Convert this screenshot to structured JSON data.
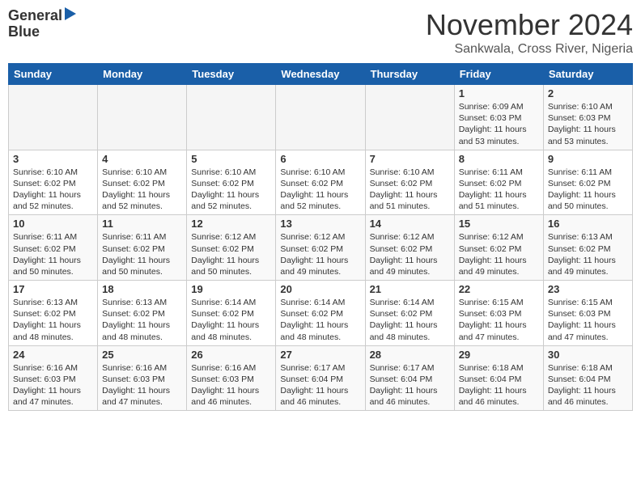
{
  "header": {
    "logo_line1": "General",
    "logo_line2": "Blue",
    "title": "November 2024",
    "subtitle": "Sankwala, Cross River, Nigeria"
  },
  "weekdays": [
    "Sunday",
    "Monday",
    "Tuesday",
    "Wednesday",
    "Thursday",
    "Friday",
    "Saturday"
  ],
  "weeks": [
    [
      {
        "day": "",
        "info": ""
      },
      {
        "day": "",
        "info": ""
      },
      {
        "day": "",
        "info": ""
      },
      {
        "day": "",
        "info": ""
      },
      {
        "day": "",
        "info": ""
      },
      {
        "day": "1",
        "info": "Sunrise: 6:09 AM\nSunset: 6:03 PM\nDaylight: 11 hours and 53 minutes."
      },
      {
        "day": "2",
        "info": "Sunrise: 6:10 AM\nSunset: 6:03 PM\nDaylight: 11 hours and 53 minutes."
      }
    ],
    [
      {
        "day": "3",
        "info": "Sunrise: 6:10 AM\nSunset: 6:02 PM\nDaylight: 11 hours and 52 minutes."
      },
      {
        "day": "4",
        "info": "Sunrise: 6:10 AM\nSunset: 6:02 PM\nDaylight: 11 hours and 52 minutes."
      },
      {
        "day": "5",
        "info": "Sunrise: 6:10 AM\nSunset: 6:02 PM\nDaylight: 11 hours and 52 minutes."
      },
      {
        "day": "6",
        "info": "Sunrise: 6:10 AM\nSunset: 6:02 PM\nDaylight: 11 hours and 52 minutes."
      },
      {
        "day": "7",
        "info": "Sunrise: 6:10 AM\nSunset: 6:02 PM\nDaylight: 11 hours and 51 minutes."
      },
      {
        "day": "8",
        "info": "Sunrise: 6:11 AM\nSunset: 6:02 PM\nDaylight: 11 hours and 51 minutes."
      },
      {
        "day": "9",
        "info": "Sunrise: 6:11 AM\nSunset: 6:02 PM\nDaylight: 11 hours and 50 minutes."
      }
    ],
    [
      {
        "day": "10",
        "info": "Sunrise: 6:11 AM\nSunset: 6:02 PM\nDaylight: 11 hours and 50 minutes."
      },
      {
        "day": "11",
        "info": "Sunrise: 6:11 AM\nSunset: 6:02 PM\nDaylight: 11 hours and 50 minutes."
      },
      {
        "day": "12",
        "info": "Sunrise: 6:12 AM\nSunset: 6:02 PM\nDaylight: 11 hours and 50 minutes."
      },
      {
        "day": "13",
        "info": "Sunrise: 6:12 AM\nSunset: 6:02 PM\nDaylight: 11 hours and 49 minutes."
      },
      {
        "day": "14",
        "info": "Sunrise: 6:12 AM\nSunset: 6:02 PM\nDaylight: 11 hours and 49 minutes."
      },
      {
        "day": "15",
        "info": "Sunrise: 6:12 AM\nSunset: 6:02 PM\nDaylight: 11 hours and 49 minutes."
      },
      {
        "day": "16",
        "info": "Sunrise: 6:13 AM\nSunset: 6:02 PM\nDaylight: 11 hours and 49 minutes."
      }
    ],
    [
      {
        "day": "17",
        "info": "Sunrise: 6:13 AM\nSunset: 6:02 PM\nDaylight: 11 hours and 48 minutes."
      },
      {
        "day": "18",
        "info": "Sunrise: 6:13 AM\nSunset: 6:02 PM\nDaylight: 11 hours and 48 minutes."
      },
      {
        "day": "19",
        "info": "Sunrise: 6:14 AM\nSunset: 6:02 PM\nDaylight: 11 hours and 48 minutes."
      },
      {
        "day": "20",
        "info": "Sunrise: 6:14 AM\nSunset: 6:02 PM\nDaylight: 11 hours and 48 minutes."
      },
      {
        "day": "21",
        "info": "Sunrise: 6:14 AM\nSunset: 6:02 PM\nDaylight: 11 hours and 48 minutes."
      },
      {
        "day": "22",
        "info": "Sunrise: 6:15 AM\nSunset: 6:03 PM\nDaylight: 11 hours and 47 minutes."
      },
      {
        "day": "23",
        "info": "Sunrise: 6:15 AM\nSunset: 6:03 PM\nDaylight: 11 hours and 47 minutes."
      }
    ],
    [
      {
        "day": "24",
        "info": "Sunrise: 6:16 AM\nSunset: 6:03 PM\nDaylight: 11 hours and 47 minutes."
      },
      {
        "day": "25",
        "info": "Sunrise: 6:16 AM\nSunset: 6:03 PM\nDaylight: 11 hours and 47 minutes."
      },
      {
        "day": "26",
        "info": "Sunrise: 6:16 AM\nSunset: 6:03 PM\nDaylight: 11 hours and 46 minutes."
      },
      {
        "day": "27",
        "info": "Sunrise: 6:17 AM\nSunset: 6:04 PM\nDaylight: 11 hours and 46 minutes."
      },
      {
        "day": "28",
        "info": "Sunrise: 6:17 AM\nSunset: 6:04 PM\nDaylight: 11 hours and 46 minutes."
      },
      {
        "day": "29",
        "info": "Sunrise: 6:18 AM\nSunset: 6:04 PM\nDaylight: 11 hours and 46 minutes."
      },
      {
        "day": "30",
        "info": "Sunrise: 6:18 AM\nSunset: 6:04 PM\nDaylight: 11 hours and 46 minutes."
      }
    ]
  ]
}
